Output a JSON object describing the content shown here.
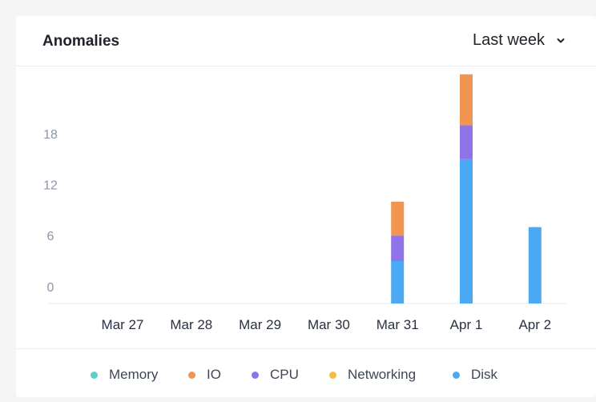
{
  "card": {
    "title": "Anomalies",
    "range_label": "Last week"
  },
  "colors": {
    "Memory": "#5ccfc9",
    "IO": "#f19550",
    "CPU": "#8f73e8",
    "Networking": "#f4be40",
    "Disk": "#4aa9f2",
    "axis_text": "#8d96ab",
    "tick_text": "#2b3040"
  },
  "legend": [
    "Memory",
    "IO",
    "CPU",
    "Networking",
    "Disk"
  ],
  "chart_data": {
    "type": "bar",
    "stacked": true,
    "categories": [
      "Mar 27",
      "Mar 28",
      "Mar 29",
      "Mar 30",
      "Mar 31",
      "Apr 1",
      "Apr 2"
    ],
    "series": [
      {
        "name": "Memory",
        "values": [
          0,
          0,
          0,
          0,
          0,
          0,
          0
        ]
      },
      {
        "name": "IO",
        "values": [
          0,
          0,
          0,
          0,
          4,
          6,
          0
        ]
      },
      {
        "name": "CPU",
        "values": [
          0,
          0,
          0,
          0,
          3,
          4,
          0
        ]
      },
      {
        "name": "Networking",
        "values": [
          0,
          0,
          0,
          0,
          0,
          0,
          0
        ]
      },
      {
        "name": "Disk",
        "values": [
          0,
          0,
          0,
          0,
          5,
          17,
          9
        ]
      }
    ],
    "yticks": [
      0,
      6,
      12,
      18
    ],
    "ylim": [
      -2,
      25
    ],
    "grid": false,
    "legend_position": "bottom"
  }
}
